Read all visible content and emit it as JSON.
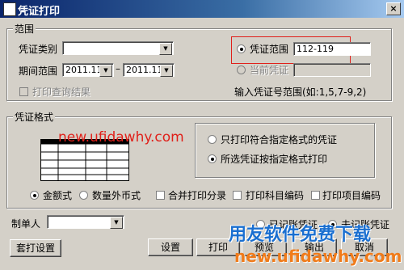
{
  "window": {
    "title": "凭证打印",
    "close": "×"
  },
  "range": {
    "legend": "范围",
    "voucher_type_label": "凭证类别",
    "voucher_type_value": "",
    "period_label": "期间范围",
    "period_from": "2011.11",
    "period_to": "2011.11",
    "print_query_results": "打印查询结果",
    "voucher_range_label": "凭证范围",
    "voucher_range_value": "112-119",
    "current_voucher_label": "当前凭证",
    "hint": "输入凭证号范围(如:1,5,7-9,2)"
  },
  "format": {
    "legend": "凭证格式",
    "watermark": "new.ufidawhy.com",
    "only_matching": "只打印符合指定格式的凭证",
    "all_by_format": "所选凭证按指定格式打印"
  },
  "options": {
    "amount_style": "金额式",
    "foreign_style": "数量外币式",
    "merge_entries": "合并打印分录",
    "print_subject_code": "打印科目编码",
    "print_item_code": "打印项目编码"
  },
  "preparer": {
    "label": "制单人",
    "value": ""
  },
  "status": {
    "posted": "已记账凭证",
    "unposted": "未记账凭证"
  },
  "buttons": {
    "template": "套打设置",
    "settings": "设置",
    "print": "打印",
    "preview": "预览",
    "export": "输出",
    "cancel": "取消"
  },
  "watermark": {
    "brand": "用友软件免费下载",
    "url": "new.ufidawhy.com"
  }
}
